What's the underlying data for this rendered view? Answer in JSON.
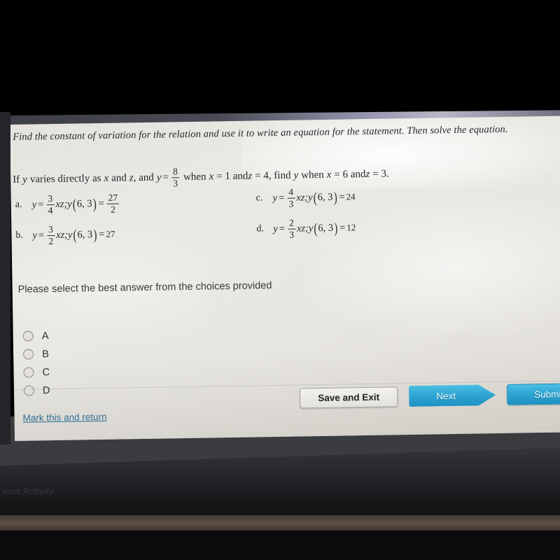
{
  "device": {
    "faint_os_text": "ious Activity"
  },
  "quiz": {
    "prompt": "Find the constant of variation for the relation and use it to write an equation for the statement. Then solve the equation.",
    "question": {
      "lead": "If",
      "v1": "y",
      "mid1": "varies directly as",
      "v2": "x",
      "and1": "and",
      "v3": "z",
      "and2": ", and",
      "v4": "y",
      "eq": "=",
      "fraction": {
        "num": "8",
        "den": "3"
      },
      "mid2": "when",
      "v5": "x",
      "eq2": "= 1 and",
      "v6": "z",
      "eq3": "= 4, find",
      "v7": "y",
      "mid3": "when",
      "v8": "x",
      "eq4": "= 6 and",
      "v9": "z",
      "eq5": "= 3."
    },
    "choices": [
      {
        "letter": "a.",
        "y": "y",
        "eq": "=",
        "coef": {
          "num": "3",
          "den": "4"
        },
        "vars": "xz;",
        "fn": "y",
        "args": "6, 3",
        "eq2": "=",
        "result_num": "27",
        "result_den": "2",
        "result_kind": "fraction"
      },
      {
        "letter": "b.",
        "y": "y",
        "eq": "=",
        "coef": {
          "num": "3",
          "den": "2"
        },
        "vars": "xz;",
        "fn": "y",
        "args": "6, 3",
        "eq2": "=",
        "result": "27",
        "result_kind": "scalar"
      },
      {
        "letter": "c.",
        "y": "y",
        "eq": "=",
        "coef": {
          "num": "4",
          "den": "3"
        },
        "vars": "xz;",
        "fn": "y",
        "args": "6, 3",
        "eq2": "=",
        "result": "24",
        "result_kind": "scalar"
      },
      {
        "letter": "d.",
        "y": "y",
        "eq": "=",
        "coef": {
          "num": "2",
          "den": "3"
        },
        "vars": "xz;",
        "fn": "y",
        "args": "6, 3",
        "eq2": "=",
        "result": "12",
        "result_kind": "scalar"
      }
    ],
    "select_instruction": "Please select the best answer from the choices provided",
    "radio_options": [
      {
        "label": "A",
        "selected": false
      },
      {
        "label": "B",
        "selected": false
      },
      {
        "label": "C",
        "selected": false
      },
      {
        "label": "D",
        "selected": false
      }
    ]
  },
  "footer": {
    "save_and_exit_label": "Save and Exit",
    "next_label": "Next",
    "submit_label": "Submit",
    "mark_and_return_label": "Mark this and return"
  },
  "colors": {
    "accent_blue": "#2ba3d2",
    "link_blue": "#2f6f93",
    "page_bg": "#e9e7e2",
    "bezel": "#242529"
  }
}
